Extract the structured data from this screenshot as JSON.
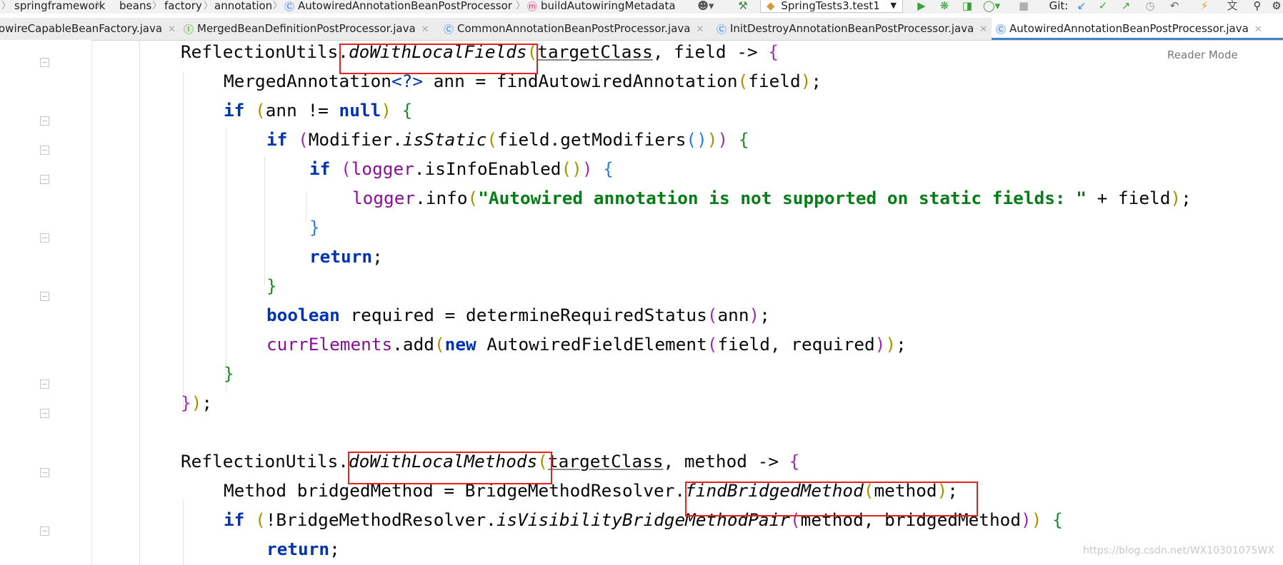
{
  "breadcrumb": [
    "springframework",
    "beans",
    "factory",
    "annotation",
    "AutowiredAnnotationBeanPostProcessor",
    "buildAutowiringMetadata"
  ],
  "toolbar": {
    "run_config": "SpringTests3.test1",
    "git_label": "Git:",
    "icons": [
      "user-icon",
      "build-hammer-icon",
      "run-icon",
      "debug-icon",
      "coverage-icon",
      "profile-icon",
      "stop-icon",
      "git-update-icon",
      "git-commit-icon",
      "git-push-icon",
      "history-icon",
      "rollback-icon",
      "translate-icon",
      "search-icon"
    ]
  },
  "tabs": [
    {
      "label": "owireCapableBeanFactory.java",
      "icon": "class-icon"
    },
    {
      "label": "MergedBeanDefinitionPostProcessor.java",
      "icon": "interface-icon"
    },
    {
      "label": "CommonAnnotationBeanPostProcessor.java",
      "icon": "class-icon"
    },
    {
      "label": "InitDestroyAnnotationBeanPostProcessor.java",
      "icon": "class-icon"
    },
    {
      "label": "AutowiredAnnotationBeanPostProcessor.java",
      "icon": "class-icon",
      "active": true
    }
  ],
  "editor": {
    "reader_mode": "Reader Mode",
    "code_lines": [
      "ReflectionUtils.doWithLocalFields(targetClass, field -> {",
      "MergedAnnotation<?> ann = findAutowiredAnnotation(field);",
      "if (ann != null) {",
      "if (Modifier.isStatic(field.getModifiers())) {",
      "if (logger.isInfoEnabled()) {",
      "logger.info(\"Autowired annotation is not supported on static fields: \" + field);",
      "}",
      "return;",
      "}",
      "boolean required = determineRequiredStatus(ann);",
      "currElements.add(new AutowiredFieldElement(field, required));",
      "}",
      "});",
      "",
      "ReflectionUtils.doWithLocalMethods(targetClass, method -> {",
      "Method bridgedMethod = BridgeMethodResolver.findBridgedMethod(method);",
      "if (!BridgeMethodResolver.isVisibilityBridgeMethodPair(method, bridgedMethod)) {",
      "return;"
    ]
  },
  "watermark": "https://blog.csdn.net/WX10301075WX"
}
